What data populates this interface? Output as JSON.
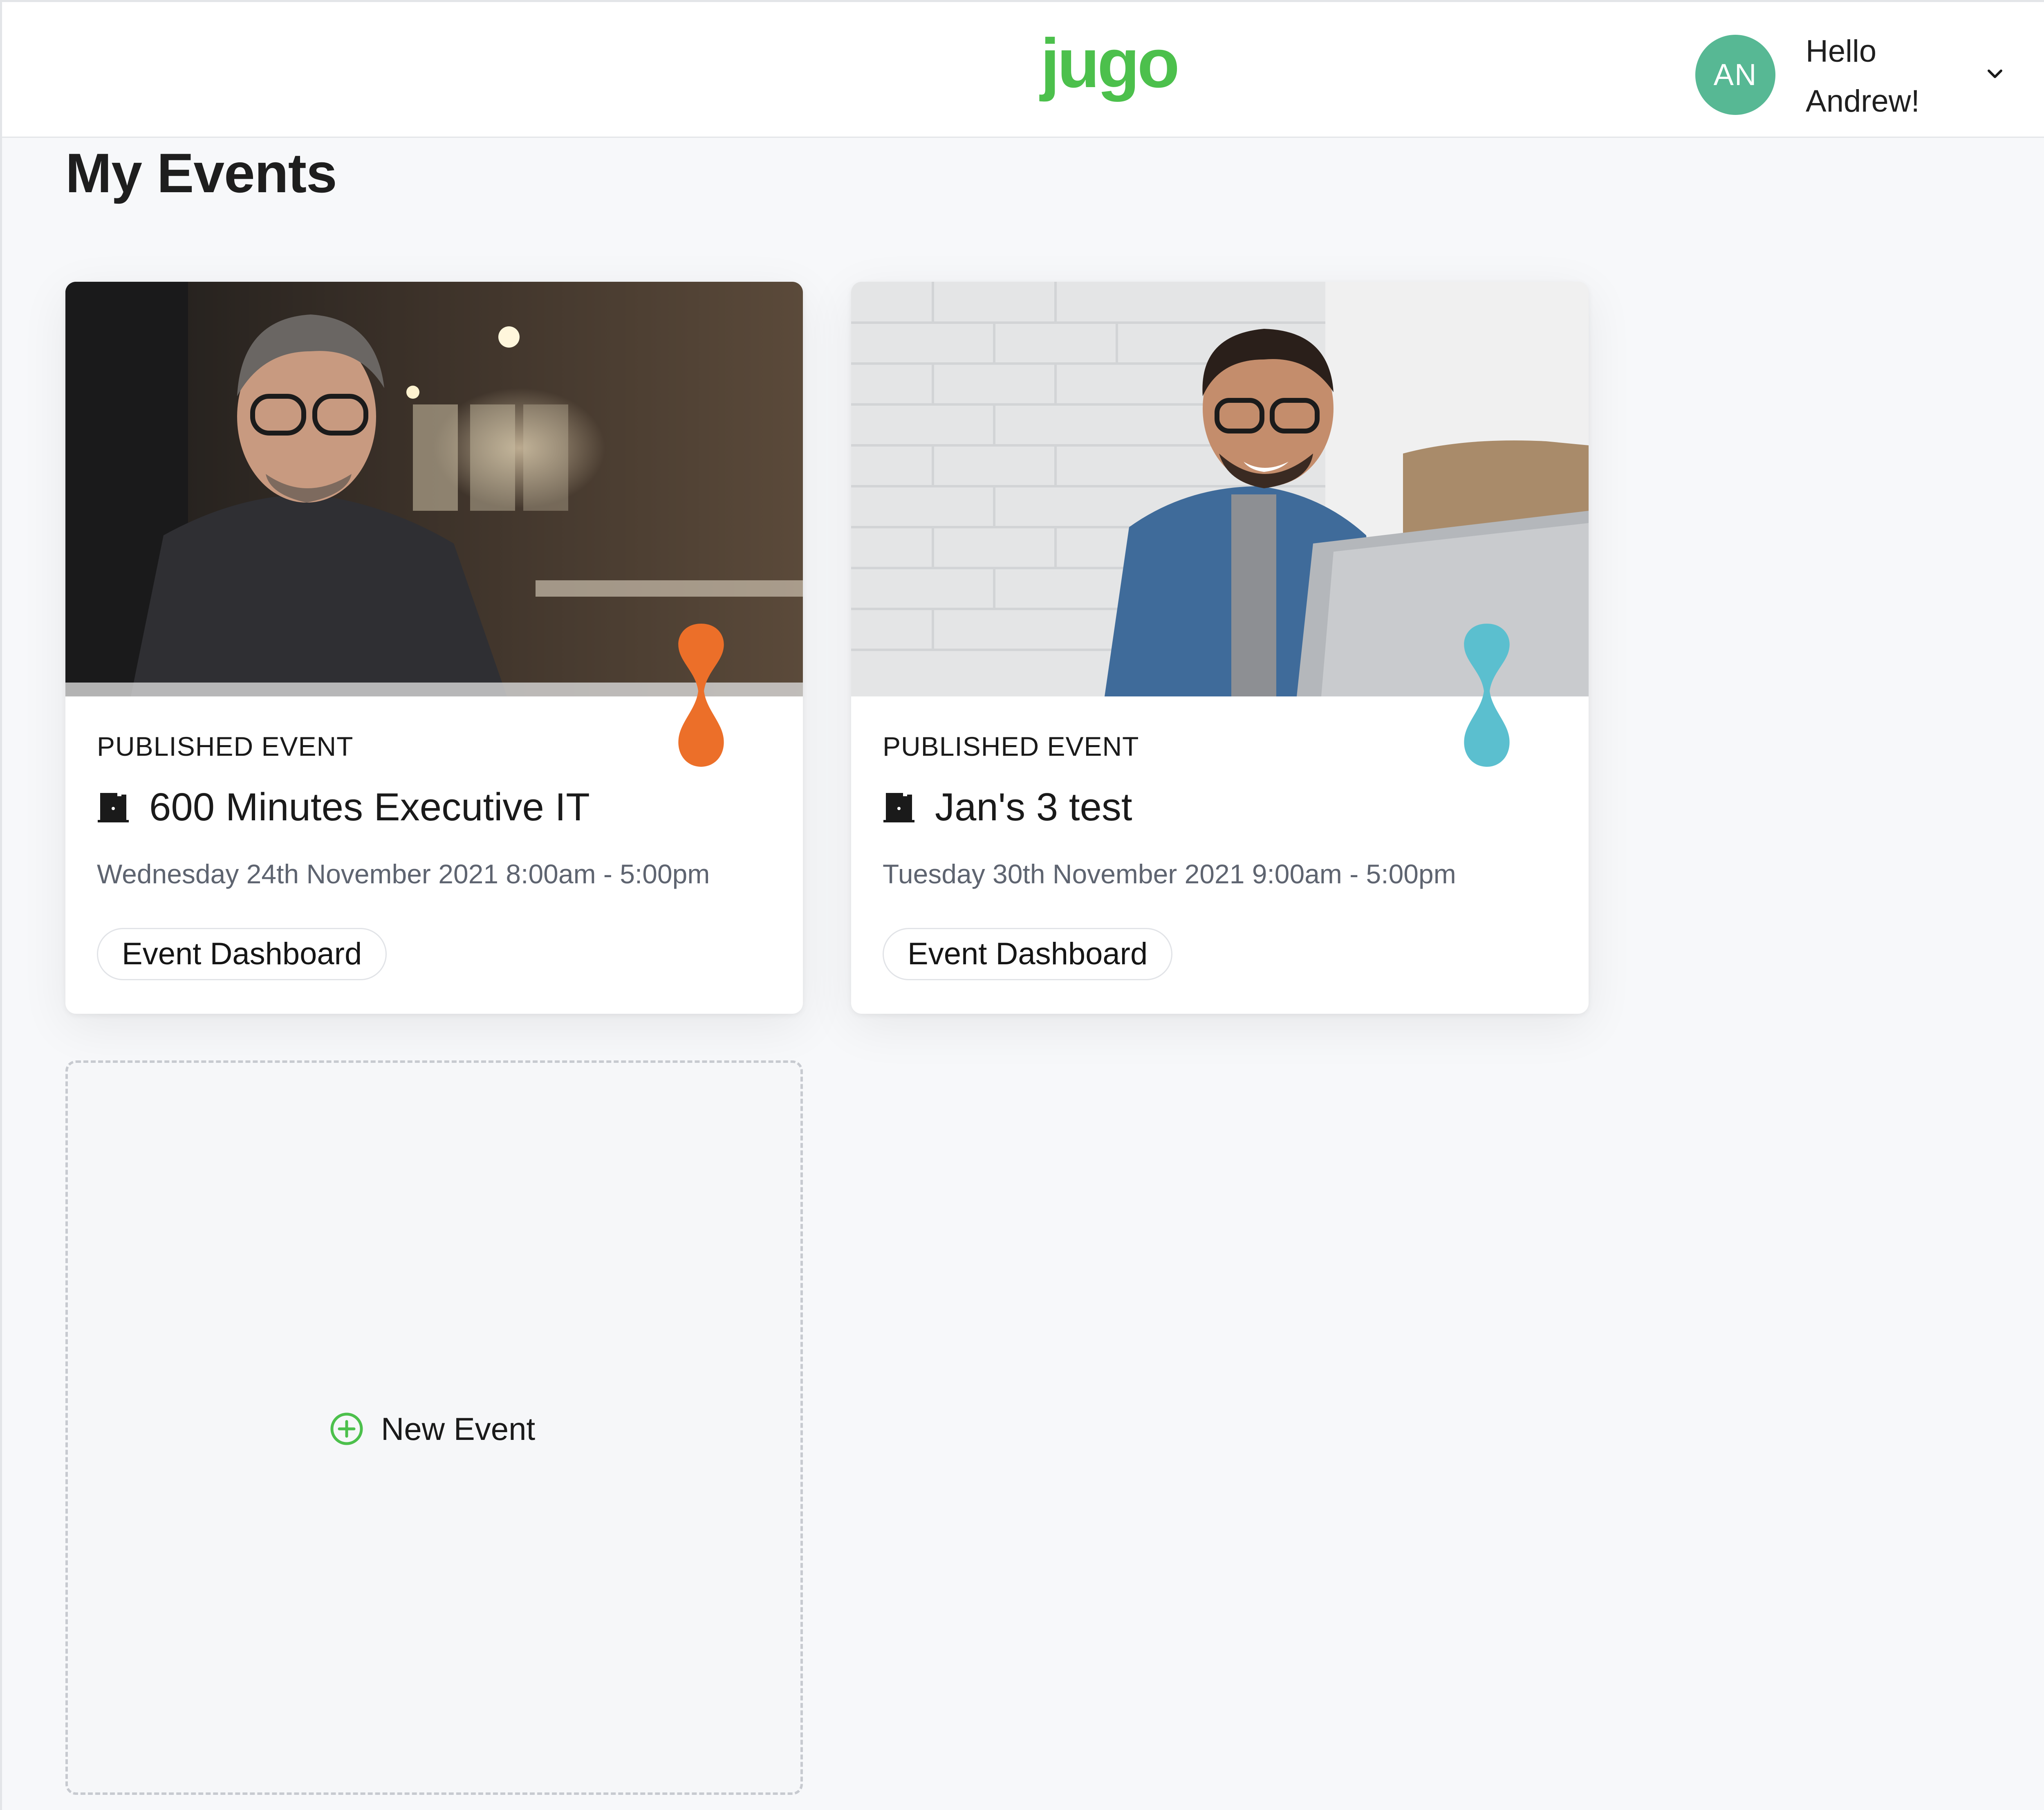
{
  "header": {
    "logo_text": "jugo",
    "avatar_initials": "AN",
    "greeting_line1": "Hello",
    "greeting_line2": "Andrew!"
  },
  "page": {
    "title": "My Events"
  },
  "events": [
    {
      "status": "PUBLISHED EVENT",
      "title": "600 Minutes Executive IT",
      "date": "Wednesday 24th November 2021 8:00am - 5:00pm",
      "button_label": "Event Dashboard",
      "pin_color": "#ec6f29",
      "icon": "door-icon"
    },
    {
      "status": "PUBLISHED EVENT",
      "title": "Jan's 3 test",
      "date": "Tuesday 30th November 2021 9:00am - 5:00pm",
      "button_label": "Event Dashboard",
      "pin_color": "#5bbfcf",
      "icon": "door-icon"
    }
  ],
  "new_event": {
    "label": "New Event",
    "icon": "plus-circle-icon"
  },
  "colors": {
    "brand": "#4cc04c",
    "avatar": "#57b894",
    "page_bg": "#f7f8fa"
  }
}
